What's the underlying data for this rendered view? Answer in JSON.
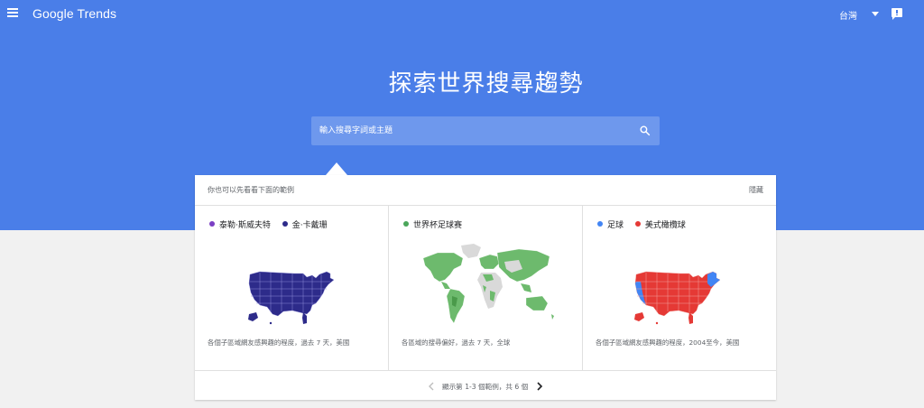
{
  "header": {
    "logo": "Google Trends",
    "region": "台灣"
  },
  "hero": {
    "title": "探索世界搜尋趨勢",
    "search_placeholder": "輸入搜尋字詞或主題"
  },
  "examples": {
    "intro": "你也可以先看看下面的範例",
    "hide_label": "隱藏",
    "cards": [
      {
        "legend": [
          {
            "label": "泰勒·斯威夫特",
            "color": "#7b3fc4"
          },
          {
            "label": "金·卡戴珊",
            "color": "#2d2b8a"
          }
        ],
        "map_color": "#2d2b8a",
        "caption": "各個子區域網友感興趣的程度，過去 7 天，美國"
      },
      {
        "legend": [
          {
            "label": "世界杯足球赛",
            "color": "#4aa65a"
          }
        ],
        "map_color": "#6dba6d",
        "caption": "各區域的搜尋偏好，過去 7 天，全球"
      },
      {
        "legend": [
          {
            "label": "足球",
            "color": "#4285f4"
          },
          {
            "label": "美式橄欖球",
            "color": "#e53935"
          }
        ],
        "map_color": "#e53935",
        "map_color_secondary": "#4285f4",
        "caption": "各個子區域網友感興趣的程度，2004至今，美國"
      }
    ],
    "pager": "顯示第 1-3 個範例，共 6 個"
  }
}
